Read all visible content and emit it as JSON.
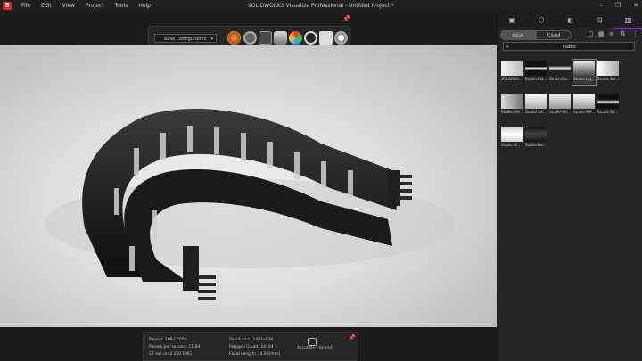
{
  "app": {
    "title": "SOLIDWORKS Visualize Professional - Untitled Project *",
    "logo_text": "S",
    "menu": [
      "File",
      "Edit",
      "View",
      "Project",
      "Tools",
      "Help"
    ],
    "window_controls": [
      "–",
      "❐",
      "✕"
    ]
  },
  "toolbar": {
    "configuration": "Base Configuration",
    "chevron": "▾",
    "pin": "📌"
  },
  "status": {
    "passes": "Passes: 109 / 2000",
    "passes_per_second": "Passes per second: 11.84",
    "time_until": "12 sec until 250 [OK]",
    "resolution": "Resolution: 1481x838",
    "polygon_count": "Polygon Count: 24104",
    "focal_length": "Focal Length: 74.00[mm]",
    "render_mode": "Accurate - Hybrid",
    "pin": "📌"
  },
  "sidebar": {
    "tabs": [
      "▣",
      "⬡",
      "◐",
      "⊡",
      "▥"
    ],
    "active_tab": 4,
    "source_local": "Local",
    "source_cloud": "Cloud",
    "folder_filter": "Plates",
    "items": [
      {
        "label": "SOLIDWO...",
        "bg": "linear-gradient(90deg,#f4f4f4,#bdbdbd)"
      },
      {
        "label": "Studio Bla...",
        "bg": "linear-gradient(180deg,#111 0%,#111 40%,#fff 50%,#111 60%,#111 100%)"
      },
      {
        "label": "Studio Da...",
        "bg": "linear-gradient(180deg,#222 0%,#222 35%,#eee 50%,#222 65%,#222 100%)"
      },
      {
        "label": "Studio Lig...",
        "bg": "linear-gradient(180deg,#eee 0%,#999 50%,#444 100%)"
      },
      {
        "label": "Studio Sof...",
        "bg": "linear-gradient(90deg,#fff,#aaa)"
      },
      {
        "label": "Studio Sof...",
        "bg": "linear-gradient(90deg,#ddd,#777)"
      },
      {
        "label": "Studio Sof...",
        "bg": "linear-gradient(180deg,#fff,#aaa)"
      },
      {
        "label": "Studio Sof...",
        "bg": "linear-gradient(180deg,#eee,#999)"
      },
      {
        "label": "Studio Sof...",
        "bg": "linear-gradient(180deg,#fff,#999)"
      },
      {
        "label": "Studio Sp...",
        "bg": "linear-gradient(180deg,#111 0%,#111 40%,#ddd 55%,#111 70%)"
      },
      {
        "label": "Studio W...",
        "bg": "linear-gradient(180deg,#ccc,#fff 50%,#ccc)"
      },
      {
        "label": "Subtle Da...",
        "bg": "linear-gradient(180deg,#111,#444 50%,#111)"
      }
    ],
    "selected_item": 3
  },
  "colors": {
    "accent": "#7a3cc2",
    "logo_red": "#d52b1e",
    "background": "#1e1e1e"
  }
}
